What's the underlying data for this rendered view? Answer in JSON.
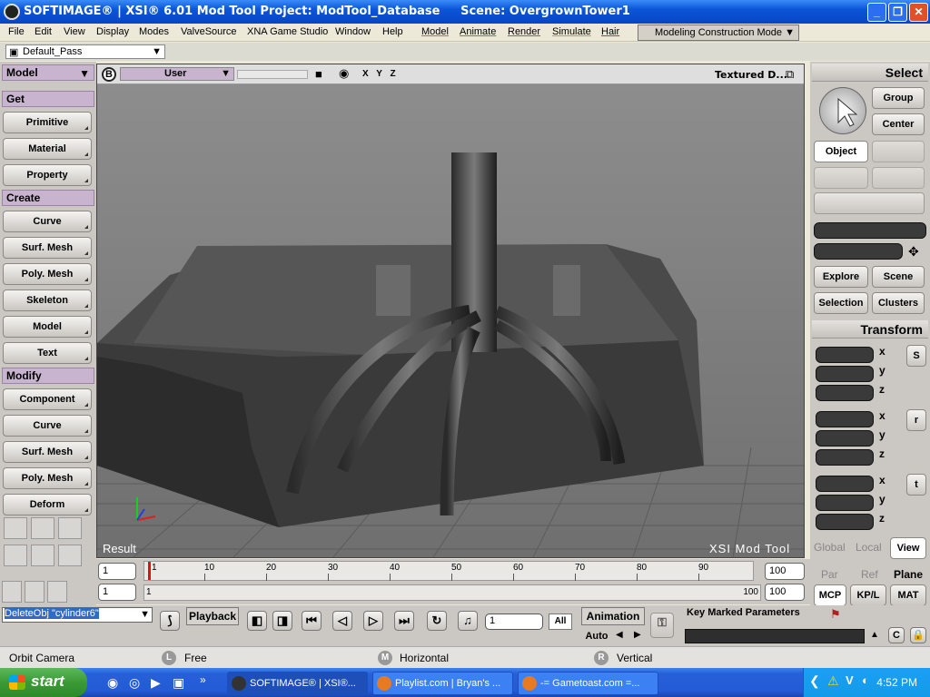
{
  "titlebar": {
    "title": "SOFTIMAGE® | XSI® 6.01 Mod Tool Project: ModTool_Database     Scene: OvergrownTower1",
    "minimize": "_",
    "restore": "❐",
    "close": "✕"
  },
  "menu": {
    "items": [
      "File",
      "Edit",
      "View",
      "Display",
      "Modes",
      "ValveSource",
      "XNA Game Studio",
      "Window",
      "Help"
    ],
    "module_items": [
      "Model",
      "Animate",
      "Render",
      "Simulate",
      "Hair"
    ],
    "mode_select": "Modeling Construction Mode"
  },
  "pass": {
    "current": "Default_Pass"
  },
  "left_panel": {
    "module": "Model",
    "sections": [
      {
        "title": "Get",
        "buttons": [
          "Primitive",
          "Material",
          "Property"
        ]
      },
      {
        "title": "Create",
        "buttons": [
          "Curve",
          "Surf. Mesh",
          "Poly. Mesh",
          "Skeleton",
          "Model",
          "Text"
        ]
      },
      {
        "title": "Modify",
        "buttons": [
          "Component",
          "Curve",
          "Surf. Mesh",
          "Poly. Mesh",
          "Deform"
        ]
      }
    ]
  },
  "viewport": {
    "camera_letter": "B",
    "camera": "User",
    "axes_label": "X Y Z",
    "display_mode": "Textured D...",
    "result_label": "Result",
    "watermark": "XSI  Mod  Tool"
  },
  "right_panel": {
    "select_header": "Select",
    "group_button": "Group",
    "center_button": "Center",
    "object_button": "Object",
    "explore_button": "Explore",
    "scene_button": "Scene",
    "selection_button": "Selection",
    "clusters_button": "Clusters",
    "transform_header": "Transform",
    "axes": [
      "x",
      "y",
      "z"
    ],
    "scale_icon": "S",
    "rotate_icon": "r",
    "translate_icon": "t",
    "ref_modes": [
      "Global",
      "Local",
      "View"
    ],
    "ref_modes2": [
      "Par",
      "Ref",
      "Plane"
    ],
    "tabs": [
      "MCP",
      "KP/L",
      "MAT"
    ]
  },
  "timeline": {
    "start_frame": "1",
    "start_frame2": "1",
    "range_start_label": "1",
    "end_frame": "100",
    "end_frame2": "100",
    "range_end_label": "100",
    "ticks": [
      "1",
      "10",
      "20",
      "30",
      "40",
      "50",
      "60",
      "70",
      "80",
      "90"
    ]
  },
  "command": {
    "input": "DeleteObj \"cylinder6\"",
    "playback_label": "Playback",
    "current_frame": "1",
    "all_label": "All",
    "animation_label": "Animation",
    "auto_label": "Auto",
    "key_marked": "Key Marked Parameters"
  },
  "status": {
    "mode": "Orbit Camera",
    "l_letter": "L",
    "l_text": "Free",
    "m_letter": "M",
    "m_text": "Horizontal",
    "r_letter": "R",
    "r_text": "Vertical"
  },
  "taskbar": {
    "start": "start",
    "tasks": [
      "SOFTIMAGE® | XSI®...",
      "Playlist.com | Bryan's ...",
      "-= Gametoast.com =..."
    ],
    "clock": "4:52 PM"
  }
}
